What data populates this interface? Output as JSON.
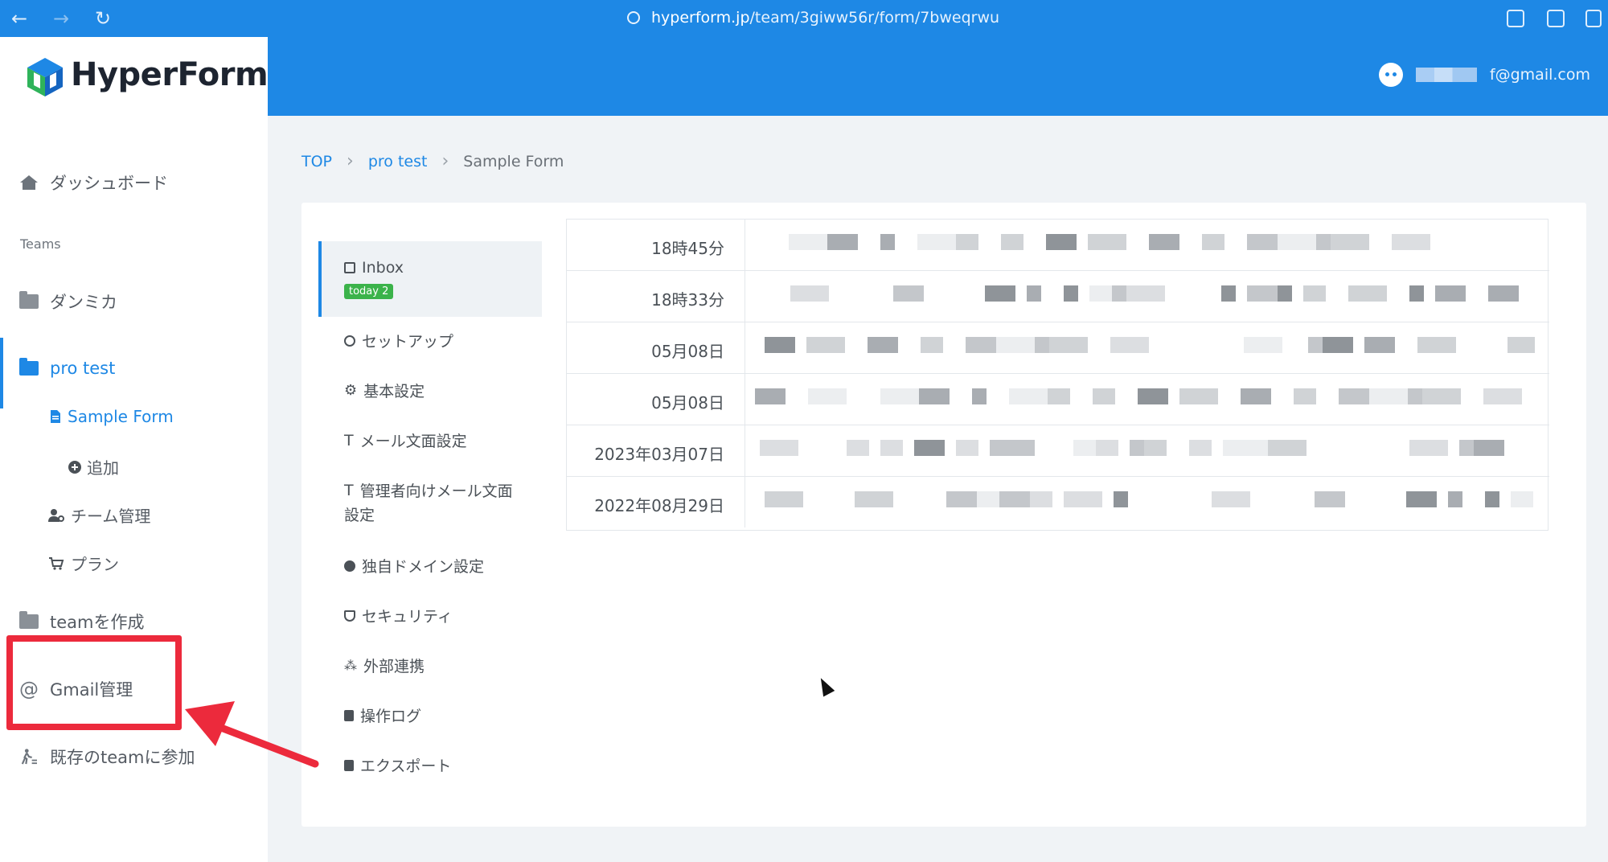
{
  "browser": {
    "url_host": "hyperform.jp",
    "url_path": "/team/3giww56r/form/7bweqrwu"
  },
  "brand": {
    "name": "HyperForm"
  },
  "header": {
    "email": "f@gmail.com"
  },
  "sidebar": {
    "dashboard": "ダッシュボード",
    "teams_label": "Teams",
    "team1": "ダンミカ",
    "team2": "pro test",
    "form": "Sample Form",
    "add": "追加",
    "team_manage": "チーム管理",
    "plan": "プラン",
    "create_team": "teamを作成",
    "gmail": "Gmail管理",
    "join_team": "既存のteamに参加"
  },
  "breadcrumb": {
    "top": "TOP",
    "team": "pro test",
    "current": "Sample Form"
  },
  "menu": {
    "inbox": "Inbox",
    "badge": "today 2",
    "setup": "セットアップ",
    "basic": "基本設定",
    "mail_text": "メール文面設定",
    "admin_mail_1": "管理者向けメール文面",
    "admin_mail_2": "設定",
    "domain": "独自ドメイン設定",
    "security": "セキュリティ",
    "integration": "外部連携",
    "log": "操作ログ",
    "export": "エクスポート"
  },
  "messages": [
    {
      "date": "18時45分"
    },
    {
      "date": "18時33分"
    },
    {
      "date": "05月08日"
    },
    {
      "date": "05月08日"
    },
    {
      "date": "2023年03月07日"
    },
    {
      "date": "2022年08月29日"
    }
  ],
  "colors": {
    "primary": "#1e88e5",
    "highlight": "#ec2a3c",
    "badge": "#3bb34a"
  }
}
